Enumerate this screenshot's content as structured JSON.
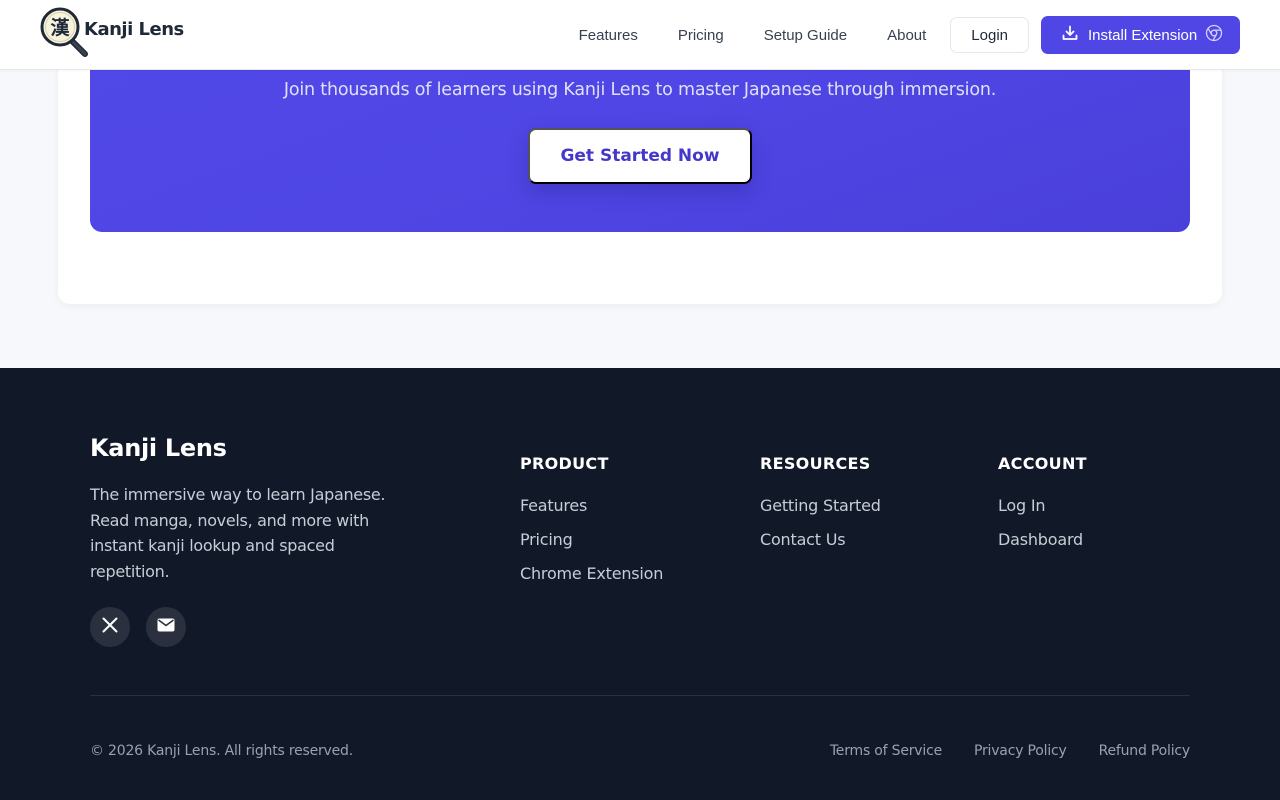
{
  "header": {
    "brand": "Kanji Lens",
    "logo_glyph": "漢",
    "nav": [
      "Features",
      "Pricing",
      "Setup Guide",
      "About"
    ],
    "login_label": "Login",
    "install_label": "Install Extension"
  },
  "cta": {
    "subtitle": "Join thousands of learners using Kanji Lens to master Japanese through immersion.",
    "button_label": "Get Started Now"
  },
  "footer": {
    "brand": "Kanji Lens",
    "description": "The immersive way to learn Japanese. Read manga, novels, and more with instant kanji lookup and spaced repetition.",
    "social": [
      "x-icon",
      "mail-icon"
    ],
    "columns": [
      {
        "title": "PRODUCT",
        "links": [
          "Features",
          "Pricing",
          "Chrome Extension"
        ]
      },
      {
        "title": "RESOURCES",
        "links": [
          "Getting Started",
          "Contact Us"
        ]
      },
      {
        "title": "ACCOUNT",
        "links": [
          "Log In",
          "Dashboard"
        ]
      }
    ],
    "copyright": "© 2026 Kanji Lens. All rights reserved.",
    "legal": [
      "Terms of Service",
      "Privacy Policy",
      "Refund Policy"
    ]
  },
  "colors": {
    "accent": "#4f46e5",
    "footer_bg": "#111827",
    "page_bg": "#f7f8fb"
  }
}
